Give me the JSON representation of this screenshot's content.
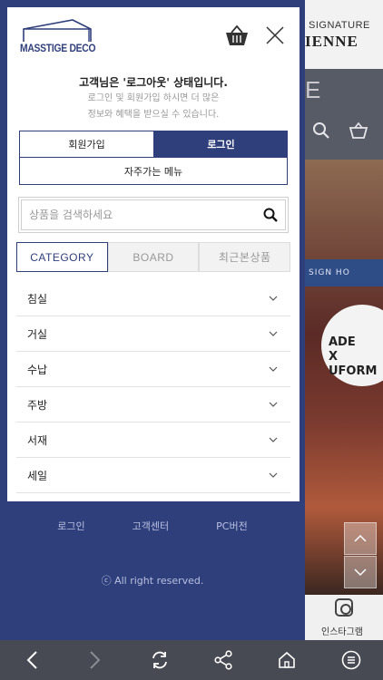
{
  "brand": {
    "logo_text": "MASSTIGE DECO"
  },
  "background": {
    "brand_sub": "SIGNATURE",
    "brand_main": "IENNE",
    "nav_letter": "E",
    "banner_text": "SIGN HO",
    "circle_text": "ADE\nX\nUFORM",
    "insta_label": "인스타그램"
  },
  "status": {
    "title": "고객님은 '로그아웃' 상태입니다.",
    "desc_line1": "로그인 및 회원가입 하시면 더 많은",
    "desc_line2": "정보와 혜택을 받으실 수 있습니다."
  },
  "auth": {
    "join": "회원가입",
    "login": "로그인",
    "frequent_menu": "자주가는 메뉴"
  },
  "search": {
    "placeholder": "상품을 검색하세요",
    "value": ""
  },
  "tabs": [
    {
      "label": "CATEGORY",
      "active": true
    },
    {
      "label": "BOARD",
      "active": false
    },
    {
      "label": "최근본상품",
      "active": false
    }
  ],
  "categories": [
    {
      "label": "침실"
    },
    {
      "label": "거실"
    },
    {
      "label": "수납"
    },
    {
      "label": "주방"
    },
    {
      "label": "서재"
    },
    {
      "label": "세일"
    }
  ],
  "footer": {
    "links": [
      "로그인",
      "고객센터",
      "PC버전"
    ],
    "copyright": "ⓒ All right reserved."
  },
  "colors": {
    "primary": "#2f3f7c",
    "bottom_bar": "#474a52"
  }
}
